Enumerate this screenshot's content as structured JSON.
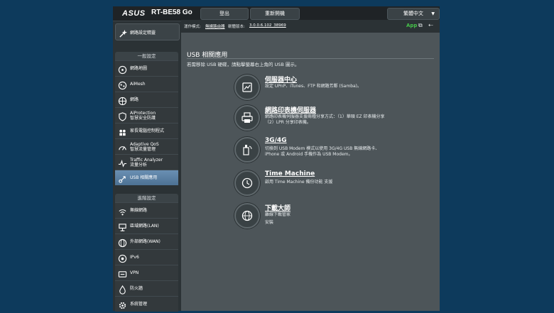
{
  "header": {
    "logo": "ASUS",
    "model": "RT-BE58 Go",
    "logout": "登出",
    "reboot": "重新開機",
    "language": "繁體中文"
  },
  "status": {
    "mode_label": "運作模式:",
    "mode_value": "無線路由器",
    "fw_label": "韌體版本:",
    "fw_value": "3.0.0.6.102_38969",
    "app": "App"
  },
  "nav": {
    "quick": "網路設定精靈",
    "general_header": "一般設定",
    "general": [
      {
        "label": "網路地圖"
      },
      {
        "label": "AiMesh"
      },
      {
        "label": "網路"
      },
      {
        "label": "AiProtection",
        "sub": "智慧安全防護"
      },
      {
        "label": "家長電腦控制程式"
      },
      {
        "label": "Adaptive QoS",
        "sub": "智慧流量管理"
      },
      {
        "label": "Traffic Analyzer",
        "sub": "流量分析"
      },
      {
        "label": "USB 相關應用"
      }
    ],
    "advanced_header": "進階設定",
    "advanced": [
      {
        "label": "無線網路"
      },
      {
        "label": "區域網路(LAN)"
      },
      {
        "label": "外部網路(WAN)"
      },
      {
        "label": "IPv6"
      },
      {
        "label": "VPN"
      },
      {
        "label": "防火牆"
      },
      {
        "label": "系統管理"
      }
    ]
  },
  "page": {
    "title": "USB 相關應用",
    "description": "若需移除 USB 硬碟，請點擊螢幕右上角的 USB 圖示。"
  },
  "features": [
    {
      "icon": "server-icon",
      "title": "伺服器中心",
      "desc": "設定 UPnP、iTunes、FTP 和網路芳鄰 (Samba)。",
      "desc2": ""
    },
    {
      "icon": "printer-icon",
      "title": "網路印表機伺服器",
      "desc": "網路印表機伺服器支援兩種分享方式：（1）華碩 EZ 印表機分享（2）LPR 分享印表機。",
      "desc2": ""
    },
    {
      "icon": "modem-icon",
      "title": "3G/4G",
      "desc": "切換到 USB Modem 模式以使用 3G/4G USB 無線網路卡、iPhone 或 Android 手機作為 USB Modem。",
      "desc2": ""
    },
    {
      "icon": "time-machine-icon",
      "title": "Time Machine",
      "desc": "啟用 Time Machine 備份功能 支援",
      "desc2": ""
    },
    {
      "icon": "download-master-icon",
      "title": "下載大師",
      "desc": "離線下載管家",
      "desc2": "安裝"
    }
  ]
}
